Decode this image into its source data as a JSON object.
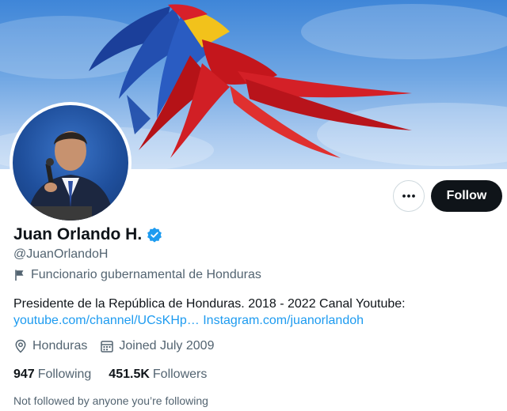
{
  "profile": {
    "name": "Juan Orlando H.",
    "handle": "@JuanOrlandoH",
    "category": "Funcionario gubernamental de Honduras",
    "bio_text": "Presidente de la República de Honduras. 2018 - 2022 Canal Youtube:",
    "bio_link_youtube": "youtube.com/channel/UCsKHp…",
    "bio_link_instagram": "Instagram.com/juanorlandoh",
    "location": "Honduras",
    "joined": "Joined July 2009",
    "following_count": "947",
    "following_label": "Following",
    "followers_count": "451.5K",
    "followers_label": "Followers",
    "followed_by": "Not followed by anyone you’re following"
  },
  "actions": {
    "follow_label": "Follow",
    "more_icon": "more-horizontal-icon"
  },
  "icons": {
    "verified": "verified-badge-icon",
    "category": "flag-icon",
    "location": "location-pin-icon",
    "calendar": "calendar-icon"
  },
  "colors": {
    "accent": "#1d9bf0",
    "text_primary": "#0f1419",
    "text_secondary": "#536471",
    "follow_button": "#0f1419"
  }
}
